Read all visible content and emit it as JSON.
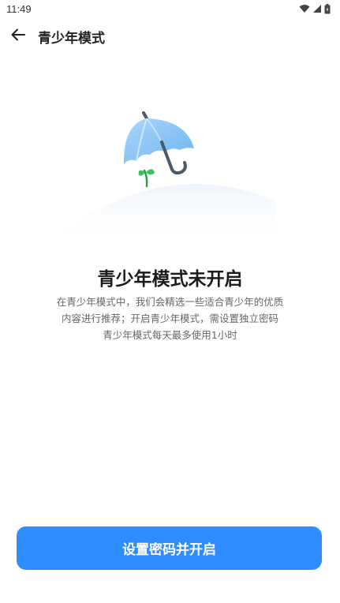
{
  "status_bar": {
    "time": "11:49",
    "icons": [
      "wifi-icon",
      "signal-icon",
      "battery-icon"
    ]
  },
  "header": {
    "back_icon": "arrow-left-icon",
    "title": "青少年模式"
  },
  "main": {
    "illustration": "umbrella-sprout-illustration",
    "heading": "青少年模式未开启",
    "description_lines": [
      "在青少年模式中，我们会精选一些适合青少年的优质",
      "内容进行推荐；开启青少年模式，需设置独立密码",
      "青少年模式每天最多使用1小时"
    ]
  },
  "footer": {
    "primary_button_label": "设置密码并开启"
  },
  "colors": {
    "accent": "#2f8cff",
    "umbrella": "#8cc8f7",
    "sprout": "#3cc15a"
  }
}
